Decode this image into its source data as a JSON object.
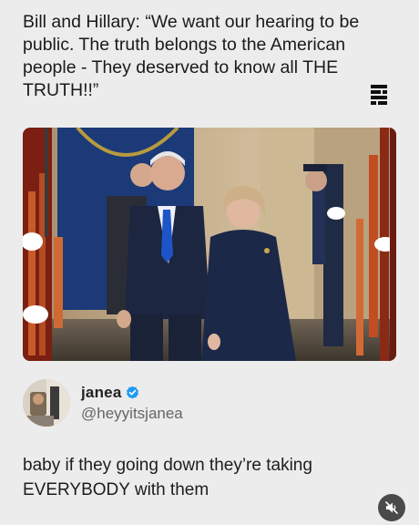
{
  "headline": "Bill and Hillary: “We want our hearing to be public. The truth belongs to the American people - They deserved to know all THE TRUTH!!”",
  "author": {
    "display_name": "janea",
    "handle": "@heyyitsjanea",
    "verified": true
  },
  "post_text": "baby if they going down they’re taking EVERYBODY with them",
  "icons": {
    "brand": "brand-logo-icon",
    "verified": "verified-badge-icon",
    "mute": "muted-speaker-icon"
  },
  "colors": {
    "background": "#ececec",
    "verified_blue": "#1d9bf0",
    "mute_button": "#4a4a4a"
  }
}
